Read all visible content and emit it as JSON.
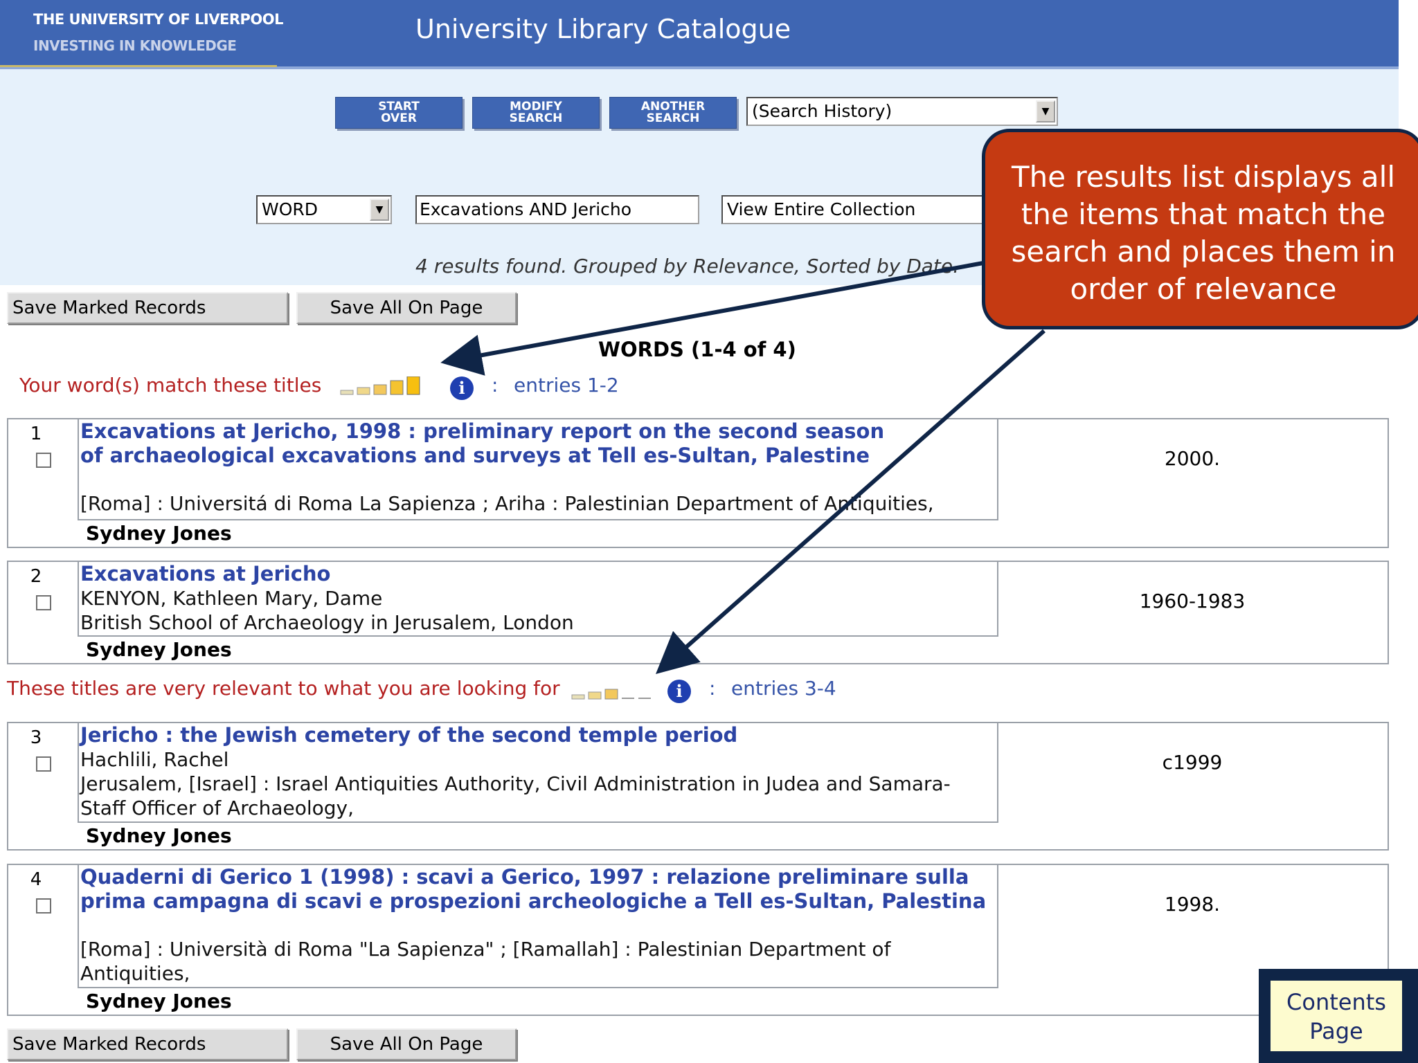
{
  "header": {
    "university": "THE UNIVERSITY OF LIVERPOOL",
    "tagline": "INVESTING IN KNOWLEDGE",
    "title": "University Library Catalogue"
  },
  "toolbar": {
    "start_over": "START\nOVER",
    "modify_search": "MODIFY\nSEARCH",
    "another_search": "ANOTHER\nSEARCH",
    "history_select": "(Search History)"
  },
  "search": {
    "type": "WORD",
    "query": "Excavations AND Jericho",
    "scope": "View Entire Collection"
  },
  "summary": "4 results found. Grouped by Relevance, Sorted by Date.",
  "actions": {
    "save_marked": "Save Marked Records",
    "save_all": "Save All On Page"
  },
  "results_heading": "WORDS (1-4 of 4)",
  "groups": [
    {
      "label": "Your word(s) match these titles",
      "colon": ":",
      "entries": "entries 1-2",
      "relevance_level": 5
    },
    {
      "label": "These titles are very relevant to what you are looking for",
      "colon": ":",
      "entries": "entries 3-4",
      "relevance_level": 3
    }
  ],
  "records": [
    {
      "num": "1",
      "title": "Excavations at Jericho, 1998 : preliminary report on the second season of archaeological excavations and surveys at Tell es-Sultan, Palestine",
      "author": "",
      "publisher": "[Roma] : Universitá di Roma La Sapienza ; Ariha : Palestinian Department of Antiquities,",
      "date": "2000.",
      "owner": "Sydney Jones"
    },
    {
      "num": "2",
      "title": "Excavations at Jericho",
      "author": "KENYON, Kathleen Mary, Dame",
      "publisher": "British School of Archaeology in Jerusalem, London",
      "date": "1960-1983",
      "owner": "Sydney Jones"
    },
    {
      "num": "3",
      "title": "Jericho : the Jewish cemetery of the second temple period",
      "author": "Hachlili, Rachel",
      "publisher_line1": "Jerusalem, [Israel] : Israel Antiquities Authority, Civil Administration in Judea and Samara-",
      "publisher_line2": "Staff Officer of Archaeology,",
      "date": "c1999",
      "owner": "Sydney Jones"
    },
    {
      "num": "4",
      "title_line1": "Quaderni di Gerico 1 (1998) : scavi a Gerico, 1997 : relazione preliminare sulla",
      "title_line2": "prima campagna di scavi e prospezioni archeologiche a Tell es-Sultan, Palestina",
      "publisher_line1": "[Roma] : Università di Roma \"La Sapienza\" ; [Ramallah] : Palestinian Department of",
      "publisher_line2": "Antiquities,",
      "date": "1998.",
      "owner": "Sydney Jones"
    }
  ],
  "callout": {
    "text": "The results list displays all the items that match the search and places them in order of relevance"
  },
  "contents_button": {
    "line1": "Contents",
    "line2": "Page"
  },
  "colors": {
    "header_blue": "#3f66b3",
    "link_blue": "#2c44a4",
    "group_red": "#b42020",
    "callout_red": "#c53a12",
    "navy": "#0f2547"
  }
}
